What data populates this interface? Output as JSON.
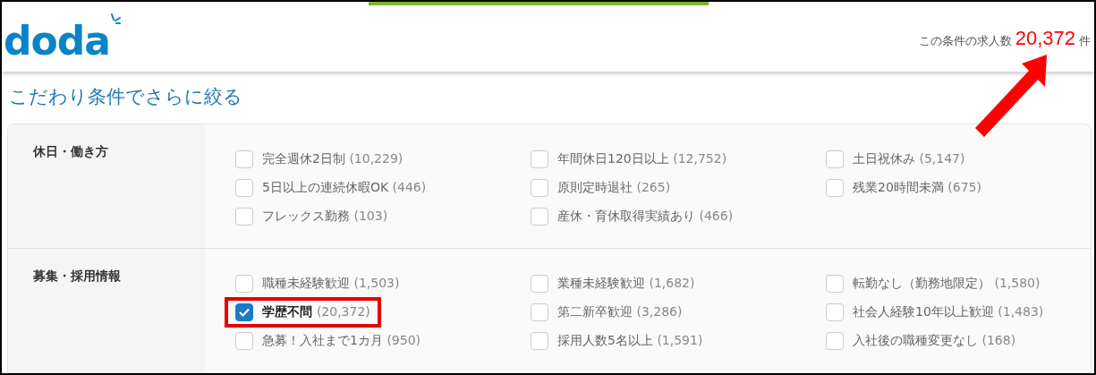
{
  "header": {
    "logo": "doda",
    "result_label": "この条件の求人数",
    "result_count": "20,372",
    "result_unit": "件"
  },
  "title": "こだわり条件でさらに絞る",
  "sections": [
    {
      "label": "休日・働き方",
      "options": [
        {
          "label": "完全週休2日制",
          "count": "(10,229)",
          "checked": false,
          "highlighted": false
        },
        {
          "label": "年間休日120日以上",
          "count": "(12,752)",
          "checked": false,
          "highlighted": false
        },
        {
          "label": "土日祝休み",
          "count": "(5,147)",
          "checked": false,
          "highlighted": false
        },
        {
          "label": "5日以上の連続休暇OK",
          "count": "(446)",
          "checked": false,
          "highlighted": false
        },
        {
          "label": "原則定時退社",
          "count": "(265)",
          "checked": false,
          "highlighted": false
        },
        {
          "label": "残業20時間未満",
          "count": "(675)",
          "checked": false,
          "highlighted": false
        },
        {
          "label": "フレックス勤務",
          "count": "(103)",
          "checked": false,
          "highlighted": false
        },
        {
          "label": "産休・育休取得実績あり",
          "count": "(466)",
          "checked": false,
          "highlighted": false
        }
      ]
    },
    {
      "label": "募集・採用情報",
      "options": [
        {
          "label": "職種未経験歓迎",
          "count": "(1,503)",
          "checked": false,
          "highlighted": false
        },
        {
          "label": "業種未経験歓迎",
          "count": "(1,682)",
          "checked": false,
          "highlighted": false
        },
        {
          "label": "転勤なし（勤務地限定）",
          "count": "(1,580)",
          "checked": false,
          "highlighted": false
        },
        {
          "label": "学歴不問",
          "count": "(20,372)",
          "checked": true,
          "highlighted": true
        },
        {
          "label": "第二新卒歓迎",
          "count": "(3,286)",
          "checked": false,
          "highlighted": false
        },
        {
          "label": "社会人経験10年以上歓迎",
          "count": "(1,483)",
          "checked": false,
          "highlighted": false
        },
        {
          "label": "急募！入社まで1カ月",
          "count": "(950)",
          "checked": false,
          "highlighted": false
        },
        {
          "label": "採用人数5名以上",
          "count": "(1,591)",
          "checked": false,
          "highlighted": false
        },
        {
          "label": "入社後の職種変更なし",
          "count": "(168)",
          "checked": false,
          "highlighted": false
        }
      ]
    }
  ]
}
